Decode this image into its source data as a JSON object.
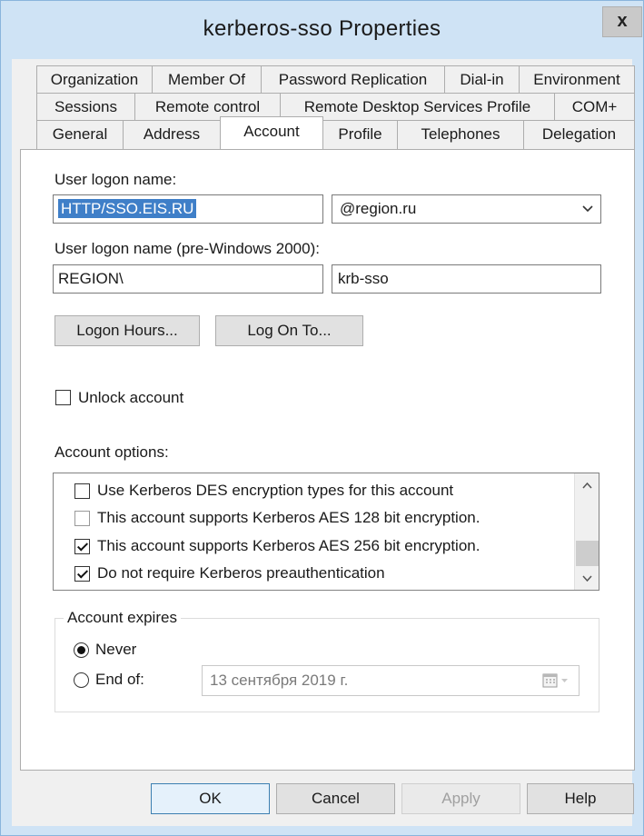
{
  "window": {
    "title": "kerberos-sso Properties",
    "close_glyph": "x"
  },
  "tabs": {
    "row1": [
      "Organization",
      "Member Of",
      "Password Replication",
      "Dial-in",
      "Environment"
    ],
    "row2": [
      "Sessions",
      "Remote control",
      "Remote Desktop Services Profile",
      "COM+"
    ],
    "row3": [
      "General",
      "Address",
      "Account",
      "Profile",
      "Telephones",
      "Delegation"
    ],
    "active": "Account"
  },
  "account": {
    "logon_name_label": "User logon name:",
    "logon_name_value": "HTTP/SSO.EIS.RU",
    "domain_value": "@region.ru",
    "pre2000_label": "User logon name (pre-Windows 2000):",
    "pre2000_domain": "REGION\\",
    "pre2000_user": "krb-sso",
    "logon_hours_button": "Logon Hours...",
    "log_on_to_button": "Log On To...",
    "unlock_label": "Unlock account",
    "unlock_checked": false,
    "options_label": "Account options:",
    "options": [
      {
        "label": "Use Kerberos DES encryption types for this account",
        "checked": false
      },
      {
        "label": "This account supports Kerberos AES 128 bit encryption.",
        "checked": false
      },
      {
        "label": "This account supports Kerberos AES 256 bit encryption.",
        "checked": true
      },
      {
        "label": "Do not require Kerberos preauthentication",
        "checked": true
      }
    ],
    "expires_label": "Account expires",
    "never_label": "Never",
    "never_selected": true,
    "end_of_label": "End of:",
    "end_of_date": "13 сентября 2019 г."
  },
  "footer": {
    "ok_label": "OK",
    "cancel_label": "Cancel",
    "apply_label": "Apply",
    "help_label": "Help"
  },
  "icons": {
    "dropdown": "chevron-down-icon",
    "scroll_up": "chevron-up-icon",
    "scroll_down": "chevron-down-icon",
    "calendar": "calendar-icon"
  },
  "colors": {
    "title_bar": "#cfe3f5",
    "selection": "#3f7fc8",
    "dialog_bg": "#f0f0f0"
  }
}
